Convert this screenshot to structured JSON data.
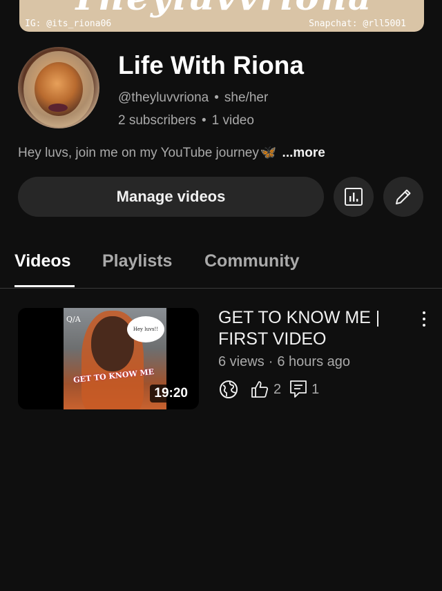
{
  "banner": {
    "title_script": "Theyluvvriona",
    "ig": "IG: @its_riona06",
    "snapchat": "Snapchat: @rll5001"
  },
  "channel": {
    "name": "Life With Riona",
    "handle": "@theyluvvriona",
    "pronouns": "she/her",
    "subscribers": "2 subscribers",
    "video_count": "1 video",
    "description": "Hey luvs, join me on my YouTube journey",
    "butterfly": "🦋",
    "more_label": "...more"
  },
  "actions": {
    "manage_label": "Manage videos",
    "analytics_icon": "analytics-icon",
    "edit_icon": "pencil-icon"
  },
  "tabs": [
    {
      "label": "Videos",
      "active": true
    },
    {
      "label": "Playlists",
      "active": false
    },
    {
      "label": "Community",
      "active": false
    }
  ],
  "videos": [
    {
      "title": "GET TO KNOW ME | FIRST VIDEO",
      "views": "6 views",
      "age": "6 hours ago",
      "duration": "19:20",
      "likes": "2",
      "comments": "1",
      "thumb_qa": "Q/A",
      "thumb_bubble": "Hey luvs!!",
      "thumb_caption": "GET TO KNOW ME"
    }
  ],
  "separator": "•",
  "meta_separator": "·"
}
